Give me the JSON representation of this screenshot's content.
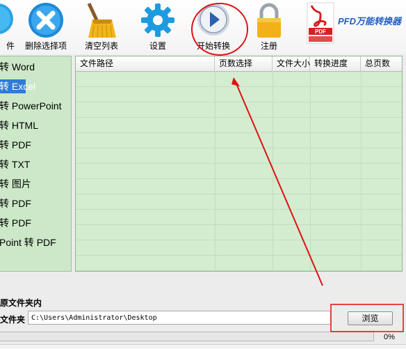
{
  "toolbar": {
    "items": [
      {
        "label": "件",
        "icon": "add-file-icon"
      },
      {
        "label": "删除选择项",
        "icon": "delete-x-icon"
      },
      {
        "label": "清空列表",
        "icon": "broom-icon"
      },
      {
        "label": "设置",
        "icon": "gear-icon"
      },
      {
        "label": "开始转换",
        "icon": "play-icon"
      },
      {
        "label": "注册",
        "icon": "lock-icon"
      }
    ],
    "brand": "PFD万能转换器",
    "brand_icon_text": "PDF"
  },
  "left_list": {
    "items": [
      "转 Word",
      "转 Excel",
      "转 PowerPoint",
      "转 HTML",
      "转 PDF",
      "转 TXT",
      "转 图片",
      "转 PDF",
      "转 PDF",
      "Point 转 PDF"
    ],
    "selected_index": 1
  },
  "table": {
    "columns": [
      "文件路径",
      "页数选择",
      "文件大小",
      "转换进度",
      "总页数"
    ],
    "rows": []
  },
  "bottom": {
    "section_label": "原文件夹内",
    "folder_label": "文件夹",
    "path_value": "C:\\Users\\Administrator\\Desktop",
    "browse_label": "浏览",
    "progress_percent": 0,
    "progress_text": "0%"
  },
  "colors": {
    "list_bg": "#cde8c8",
    "selected_bg": "#2f7bd6",
    "annotation_red": "#e01010",
    "brand_blue": "#1f5fc0"
  }
}
